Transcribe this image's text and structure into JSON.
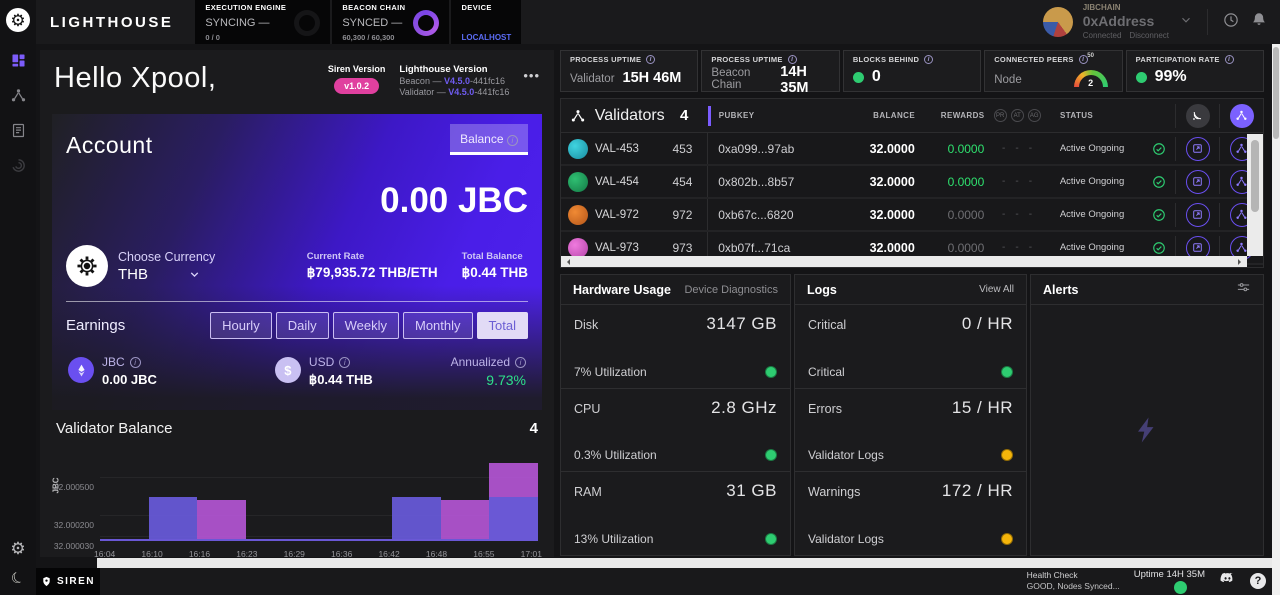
{
  "topbar": {
    "brand": "LIGHTHOUSE",
    "execution": {
      "label": "EXECUTION ENGINE",
      "status": "SYNCING —",
      "detail": "0 / 0"
    },
    "beacon": {
      "label": "BEACON CHAIN",
      "status": "SYNCED —",
      "detail": "60,300 / 60,300"
    },
    "device": {
      "label": "DEVICE",
      "value": "LOCALHOST"
    },
    "account": {
      "network": "JIBCHAIN",
      "address": "0xAddress",
      "connected": "Connected",
      "disconnect": "Disconnect"
    }
  },
  "greeting": {
    "title": "Hello Xpool,",
    "siren_version_label": "Siren Version",
    "siren_version": "v1.0.2",
    "lighthouse_version_label": "Lighthouse Version",
    "beacon_prefix": "Beacon — ",
    "beacon_version": "V4.5.0",
    "beacon_suffix": "-441fc16",
    "validator_prefix": "Validator — ",
    "validator_version": "V4.5.0",
    "validator_suffix": "-441fc16",
    "menu": "•••"
  },
  "account": {
    "title": "Account",
    "tab": "Balance",
    "balance": "0.00 JBC",
    "choose_currency_label": "Choose Currency",
    "currency": "THB",
    "current_rate_label": "Current Rate",
    "current_rate": "฿79,935.72 THB/ETH",
    "total_balance_label": "Total Balance",
    "total_balance": "฿0.44 THB"
  },
  "earnings": {
    "label": "Earnings",
    "tabs": {
      "0": "Hourly",
      "1": "Daily",
      "2": "Weekly",
      "3": "Monthly",
      "4": "Total"
    },
    "jbc_label": "JBC",
    "jbc_value": "0.00 JBC",
    "usd_label": "USD",
    "usd_value": "฿0.44 THB",
    "usd_symbol": "$",
    "annualized_label": "Annualized",
    "annualized_value": "9.73%",
    "annualized_color": "#2ee08a"
  },
  "validator_balance": {
    "title": "Validator Balance",
    "count": "4"
  },
  "chart_data": {
    "type": "bar",
    "title": "Validator Balance",
    "ylabel": "JBC",
    "x": [
      "16:04",
      "16:10",
      "16:16",
      "16:23",
      "16:29",
      "16:36",
      "16:42",
      "16:48",
      "16:55",
      "17:01"
    ],
    "yticks": [
      32.00003,
      32.0002,
      32.0005
    ],
    "ylim": [
      32.0,
      32.00075
    ],
    "grid": true,
    "legend": false,
    "series": [
      {
        "name": "validator-balance-magenta",
        "color": "rgba(183,86,216,0.9)",
        "values": [
          32.00002,
          32.00002,
          32.00033,
          32.00002,
          32.00002,
          32.00002,
          32.00002,
          32.00033,
          32.00062
        ]
      },
      {
        "name": "validator-balance-blue",
        "color": "rgba(102,88,214,0.95)",
        "values": [
          32.00002,
          32.00035,
          32.00002,
          32.00002,
          32.00002,
          32.00002,
          32.00035,
          32.00002,
          32.00035
        ]
      }
    ]
  },
  "stats": {
    "0": {
      "label": "PROCESS UPTIME",
      "sub": "Validator",
      "value": "15H 46M"
    },
    "1": {
      "label": "PROCESS UPTIME",
      "sub": "Beacon Chain",
      "value": "14H 35M"
    },
    "2": {
      "label": "BLOCKS BEHIND",
      "value": "0",
      "dot_color": "#2ecc71"
    },
    "3": {
      "label": "CONNECTED PEERS",
      "sub": "Node",
      "gauge_value": "2",
      "gauge_max": "50"
    },
    "4": {
      "label": "PARTICIPATION RATE",
      "value": "99%",
      "dot_color": "#2ecc71"
    }
  },
  "validators": {
    "title": "Validators",
    "count": "4",
    "columns": {
      "pubkey": "PUBKEY",
      "balance": "BALANCE",
      "rewards": "REWARDS",
      "status": "STATUS"
    },
    "mini": {
      "0": "PR",
      "1": "AT",
      "2": "AG"
    },
    "dash": "-",
    "rows": {
      "0": {
        "name": "VAL-453",
        "index": "453",
        "pubkey": "0xa099...97ab",
        "balance": "32.0000",
        "rewards": "0.0000",
        "rewards_style": "color:#2ee06e",
        "status": "Active Ongoing",
        "icon_style": "background:radial-gradient(circle at 35% 35%, #3fd4e0, #1a8ca0)"
      },
      "1": {
        "name": "VAL-454",
        "index": "454",
        "pubkey": "0x802b...8b57",
        "balance": "32.0000",
        "rewards": "0.0000",
        "rewards_style": "color:#2ee06e",
        "status": "Active Ongoing",
        "icon_style": "background:radial-gradient(circle at 35% 35%, #2fbf72, #147a46)"
      },
      "2": {
        "name": "VAL-972",
        "index": "972",
        "pubkey": "0xb67c...6820",
        "balance": "32.0000",
        "rewards": "0.0000",
        "rewards_style": "color:#6e6e72",
        "status": "Active Ongoing",
        "icon_style": "background:radial-gradient(circle at 35% 35%, #f08a34, #b5561a)"
      },
      "3": {
        "name": "VAL-973",
        "index": "973",
        "pubkey": "0xb07f...71ca",
        "balance": "32.0000",
        "rewards": "0.0000",
        "rewards_style": "color:#6e6e72",
        "status": "Active Ongoing",
        "icon_style": "background:radial-gradient(circle at 35% 35%, #ef7ade, #b444a8)"
      }
    }
  },
  "hardware": {
    "tab_active": "Hardware Usage",
    "tab_inactive": "Device Diagnostics",
    "rows": {
      "0": {
        "label": "Disk",
        "value": "3147 GB",
        "sub": "7% Utilization",
        "dot_style": "background:#2ecc71"
      },
      "1": {
        "label": "CPU",
        "value": "2.8 GHz",
        "sub": "0.3% Utilization",
        "dot_style": "background:#2ecc71"
      },
      "2": {
        "label": "RAM",
        "value": "31 GB",
        "sub": "13% Utilization",
        "dot_style": "background:#2ecc71"
      }
    }
  },
  "logs": {
    "title": "Logs",
    "view_all": "View All",
    "rows": {
      "0": {
        "label": "Critical",
        "value": "0 / HR",
        "sub": "Critical",
        "dot_style": "background:#2ecc71"
      },
      "1": {
        "label": "Errors",
        "value": "15 / HR",
        "sub": "Validator Logs",
        "dot_style": "background:#f5b50a"
      },
      "2": {
        "label": "Warnings",
        "value": "172 / HR",
        "sub": "Validator Logs",
        "dot_style": "background:#f5b50a"
      }
    }
  },
  "alerts": {
    "title": "Alerts"
  },
  "footer": {
    "brand": "SIREN",
    "health_label": "Health Check",
    "health_value": "GOOD, Nodes Synced...",
    "uptime_label": "Uptime 14H 35M",
    "help": "?"
  }
}
